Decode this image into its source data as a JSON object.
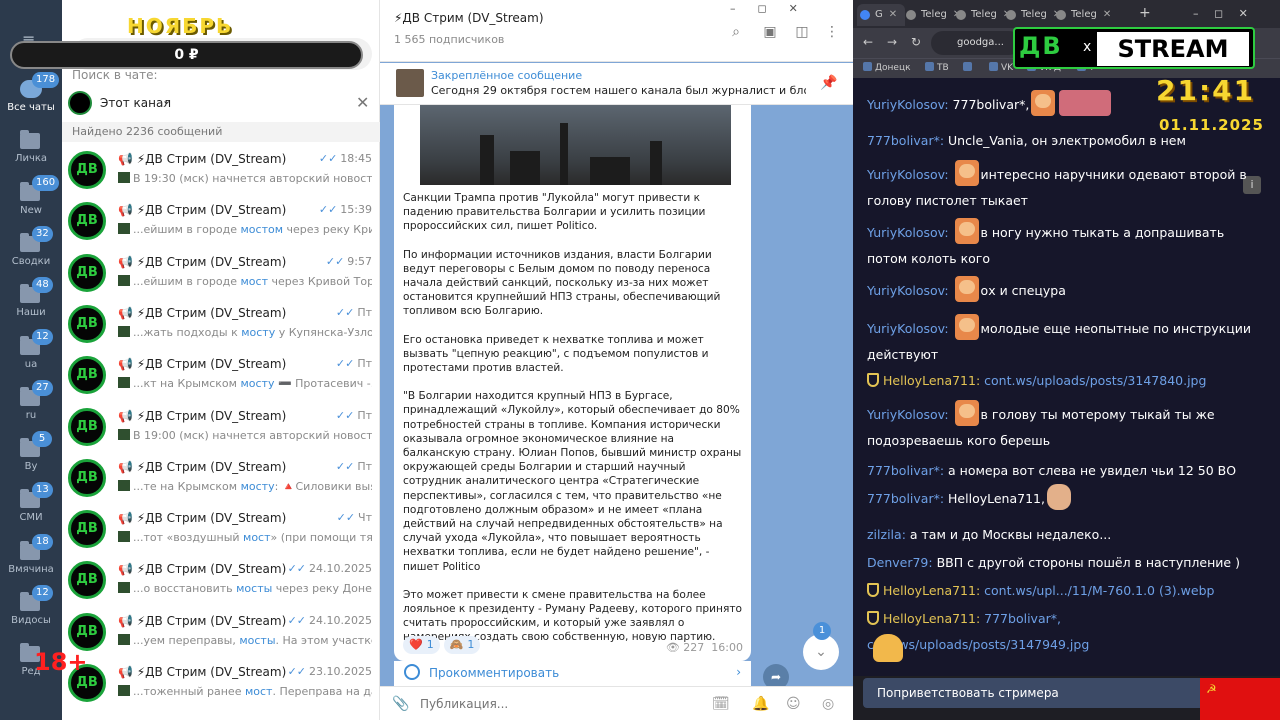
{
  "overlay": {
    "month": "НОЯБРЬ",
    "balance": "0 ₽",
    "age": "18+",
    "time": "21:41",
    "date": "01.11.2025",
    "logo_left": "ДВ",
    "logo_x": "x",
    "logo_right": "STREAM"
  },
  "nav": [
    {
      "label": "Все чаты",
      "badge": "178"
    },
    {
      "label": "Личка",
      "badge": ""
    },
    {
      "label": "New",
      "badge": "160"
    },
    {
      "label": "Сводки",
      "badge": "32"
    },
    {
      "label": "Наши",
      "badge": "48"
    },
    {
      "label": "ua",
      "badge": "12"
    },
    {
      "label": "ru",
      "badge": "27"
    },
    {
      "label": "By",
      "badge": "5"
    },
    {
      "label": "СМИ",
      "badge": "13"
    },
    {
      "label": "Вмячина",
      "badge": "18"
    },
    {
      "label": "Видосы",
      "badge": "12"
    },
    {
      "label": "Ред",
      "badge": ""
    }
  ],
  "search": {
    "in_chat_label": "Поиск в чате:",
    "filter": "Этот канал",
    "found": "Найдено 2236 сообщений"
  },
  "results": [
    {
      "title": "📢 ⚡ДВ Стрим (DV_Stream)",
      "date": "18:45",
      "pre": "В 19:30 (мск) начнется авторский новостной ...",
      "hl": "",
      "post": ""
    },
    {
      "title": "📢 ⚡ДВ Стрим (DV_Stream)",
      "date": "15:39",
      "pre": "...ейшим в городе ",
      "hl": "мостом",
      "post": " через реку Криво..."
    },
    {
      "title": "📢 ⚡ДВ Стрим (DV_Stream)",
      "date": "9:57",
      "pre": "...ейшим в городе ",
      "hl": "мост",
      "post": " через Кривой Торец..."
    },
    {
      "title": "📢 ⚡ДВ Стрим (DV_Stream)",
      "date": "Пт",
      "pre": "...жать подходы к ",
      "hl": "мосту",
      "post": " у Купянска-Узловог..."
    },
    {
      "title": "📢 ⚡ДВ Стрим (DV_Stream)",
      "date": "Пт",
      "pre": "...кт на Крымском ",
      "hl": "мосту",
      "post": " ➖ Протасевич -..."
    },
    {
      "title": "📢 ⚡ДВ Стрим (DV_Stream)",
      "date": "Пт",
      "pre": "В 19:00 (мск) начнется авторский новостной ...",
      "hl": "",
      "post": ""
    },
    {
      "title": "📢 ⚡ДВ Стрим (DV_Stream)",
      "date": "Пт",
      "pre": "...те на Крымском ",
      "hl": "мосту",
      "post": ": 🔺Силовики выяв..."
    },
    {
      "title": "📢 ⚡ДВ Стрим (DV_Stream)",
      "date": "Чт",
      "pre": "...тот «воздушный ",
      "hl": "мост",
      "post": "» (при помощи тяже..."
    },
    {
      "title": "📢 ⚡ДВ Стрим (DV_Stream)",
      "date": "24.10.2025",
      "pre": "...о восстановить ",
      "hl": "мосты",
      "post": " через реку Донец. ..."
    },
    {
      "title": "📢 ⚡ДВ Стрим (DV_Stream)",
      "date": "24.10.2025",
      "pre": "...уем переправы, ",
      "hl": "мосты",
      "post": ". На этом участке в..."
    },
    {
      "title": "📢 ⚡ДВ Стрим (DV_Stream)",
      "date": "23.10.2025",
      "pre": "...тоженный ранее ",
      "hl": "мост",
      "post": ". Переправа на дан..."
    }
  ],
  "chat": {
    "title": "⚡ДВ Стрим (DV_Stream)",
    "subscribers": "1 565 подписчиков",
    "pinned_label": "Закреплённое сообщение",
    "pinned_text": "Сегодня 29 октября гостем нашего канала был журналист и блогер...",
    "paragraphs": [
      "Санкции Трампа против \"Лукойла\" могут привести к падению правительства Болгарии и усилить позиции пророссийских сил, пишет Politico.",
      "По информации источников издания, власти Болгарии ведут переговоры с Белым домом по поводу переноса начала действий санкций, поскольку из-за них может остановится крупнейший НПЗ страны, обеспечивающий топливом всю Болгарию.",
      "Его остановка приведет к нехватке топлива и может вызвать \"цепную реакцию\", с подъемом популистов и протестами против властей.",
      "\"В Болгарии находится крупный НПЗ в Бургасе, принадлежащий «Лукойлу», который обеспечивает до 80% потребностей страны в топливе. Компания исторически оказывала огромное экономическое влияние на балканскую страну. Юлиан Попов, бывший министр охраны окружающей среды Болгарии и старший научный сотрудник аналитического центра «Стратегические перспективы», согласился с тем, что правительство «не подготовлено должным образом» и не имеет «плана действий на случай непредвиденных обстоятельств» на случай ухода «Лукойла», что повышает вероятность нехватки топлива, если не будет найдено решение\", - пишет Politico",
      "Это может привести к смене правительства на более лояльное к президенту - Руману Радееву, которого принято считать пророссийским, и который уже заявлял о намерениях создать свою собственную, новую партию."
    ],
    "reactions": [
      {
        "emoji": "❤️",
        "count": "1"
      },
      {
        "emoji": "🙈",
        "count": "1"
      }
    ],
    "views": "227",
    "time": "16:00",
    "comment": "Прокомментировать",
    "scroll_badge": "1",
    "placeholder": "Публикация..."
  },
  "browser": {
    "tabs": [
      "G",
      "Teleg",
      "Teleg",
      "Teleg",
      "Teleg"
    ],
    "omnibox": "goodga...",
    "bookmarks": [
      "Донецк",
      "ТВ",
      "",
      "VK",
      "VK Д",
      "Т"
    ],
    "messages": [
      {
        "user": "YuriyKolosov",
        "text": "777bolivar*,",
        "emote": "face,fist",
        "gold": false
      },
      {
        "user": "777bolivar*",
        "text": "Uncle_Vania, он электромобил в нем",
        "emote": "",
        "gold": false
      },
      {
        "user": "YuriyKolosov",
        "text": "интересно наручники одевают второй в голову пистолет тыкает",
        "emote": "face",
        "gold": false
      },
      {
        "user": "YuriyKolosov",
        "text": "в ногу нужно тыкать а допрашивать потом колоть кого",
        "emote": "face",
        "gold": false
      },
      {
        "user": "YuriyKolosov",
        "text": "ох и спецура",
        "emote": "face",
        "gold": false
      },
      {
        "user": "YuriyKolosov",
        "text": "молодые еще неопытные по инструкции действуют",
        "emote": "face",
        "gold": false
      },
      {
        "user": "HelloyLena711",
        "text": "cont.ws/uploads/posts/3147840.jpg",
        "emote": "",
        "gold": true
      },
      {
        "user": "YuriyKolosov",
        "text": "в голову ты мотерому тыкай ты же подозреваешь кого берешь",
        "emote": "face",
        "gold": false
      },
      {
        "user": "777bolivar*",
        "text": "а номера вот слева не увидел чьи 12 50 ВО",
        "emote": "",
        "gold": false
      },
      {
        "user": "777bolivar*",
        "text": "HelloyLena711,",
        "emote": "hand",
        "gold": false
      },
      {
        "user": "zilzila",
        "text": "а там и до Москвы недалеко...",
        "emote": "",
        "gold": false
      },
      {
        "user": "Denver79",
        "text": "ВВП с другой стороны пошёл в наступление )",
        "emote": "",
        "gold": false
      },
      {
        "user": "HelloyLena711",
        "text": "cont.ws/upl.../11/M-760.1.0 (3).webp",
        "emote": "",
        "gold": true
      },
      {
        "user": "HelloyLena711",
        "text": "777bolivar*, cont.ws/uploads/posts/3147949.jpg",
        "emote": "",
        "gold": true
      }
    ],
    "greet": "Поприветствовать стримера"
  }
}
